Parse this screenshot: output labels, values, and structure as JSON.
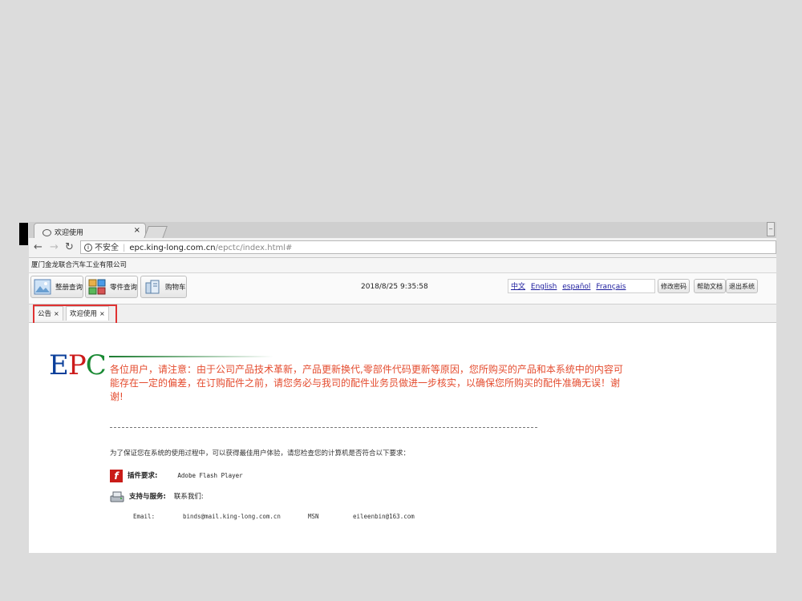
{
  "browser": {
    "tab_title": "欢迎使用",
    "tab_close": "×",
    "address": {
      "security_label": "不安全",
      "domain": "epc.king-long.com.cn",
      "path": "/epctc/index.html#"
    }
  },
  "app": {
    "company_name": "厦门金龙联合汽车工业有限公司",
    "toolbar": {
      "vehicle_query": "整册查询",
      "parts_query": "零件查询",
      "cart": "购物车"
    },
    "datetime": "2018/8/25 9:35:58",
    "languages": [
      "中文",
      "English",
      "español",
      "Français"
    ],
    "actions": {
      "change_password": "修改密码",
      "help": "帮助文档",
      "logout": "退出系统"
    },
    "page_tabs": [
      {
        "label": "公告",
        "close": "×"
      },
      {
        "label": "欢迎使用",
        "close": "×"
      }
    ]
  },
  "content": {
    "logo": {
      "e": "E",
      "p": "P",
      "c": "C"
    },
    "notice": "各位用户，请注意：由于公司产品技术革新，产品更新换代,零部件代码更新等原因，您所购买的产品和本系统中的内容可能存在一定的偏差，在订购配件之前，请您务必与我司的配件业务员做进一步核实，以确保您所购买的配件准确无误！谢谢!",
    "requirement_intro": "为了保证您在系统的使用过程中，可以获得最佳用户体验，请您检查您的计算机是否符合以下要求：",
    "plugin_label": "插件要求:",
    "plugin_value": "Adobe Flash Player",
    "support_label": "支持与服务:",
    "support_value": "联系我们:",
    "email_label": "Email:",
    "email_value": "binds@mail.king-long.com.cn",
    "msn_label": "MSN",
    "msn_value": "eileenbin@163.com"
  },
  "colors": {
    "notice_red": "#e44c2f",
    "highlight_box": "#e03232",
    "logo_blue": "#0b3f9a",
    "logo_red": "#cc1b1b",
    "logo_green": "#1a8a34"
  }
}
